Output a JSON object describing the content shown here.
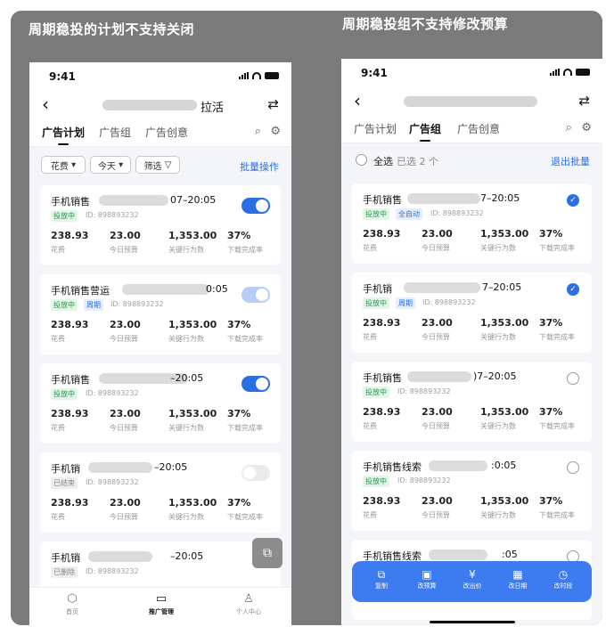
{
  "captions": {
    "left": "周期稳投的计划不支持关闭",
    "right": "周期稳投组不支持修改预算"
  },
  "status": {
    "time": "9:41"
  },
  "left_phone": {
    "nav_title": "拉活",
    "tabs": [
      "广告计划",
      "广告组",
      "广告创意"
    ],
    "active_tab": "广告计划",
    "filters": {
      "cost": "花费",
      "today": "今天",
      "filter": "筛选"
    },
    "batch": "批量操作",
    "cards": [
      {
        "name": "手机销售",
        "time": "07–20:05",
        "tags": [
          {
            "text": "投放中",
            "style": "green"
          }
        ],
        "id": "ID: 898893232",
        "toggle": "on",
        "values": [
          "238.93",
          "23.00",
          "1,353.00",
          "37%"
        ]
      },
      {
        "name": "手机销售营运",
        "time": "0:05",
        "tags": [
          {
            "text": "投放中",
            "style": "green"
          },
          {
            "text": "周期",
            "style": "blue"
          }
        ],
        "id": "ID: 898893232",
        "toggle": "dim",
        "values": [
          "238.93",
          "23.00",
          "1,353.00",
          "37%"
        ]
      },
      {
        "name": "手机销售",
        "time": "–20:05",
        "tags": [
          {
            "text": "投放中",
            "style": "green"
          }
        ],
        "id": "ID: 898893232",
        "toggle": "on",
        "values": [
          "238.93",
          "23.00",
          "1,353.00",
          "37%"
        ]
      },
      {
        "name": "手机销",
        "time": "–20:05",
        "tags": [
          {
            "text": "已结束",
            "style": "gray"
          }
        ],
        "id": "ID: 898893232",
        "toggle": "off",
        "values": [
          "238.93",
          "23.00",
          "1,353.00",
          "37%"
        ]
      },
      {
        "name": "手机销",
        "time": "–20:05",
        "tags": [
          {
            "text": "已删除",
            "style": "gray"
          }
        ],
        "id": "ID: 898893232",
        "toggle": "none",
        "values": []
      }
    ],
    "metric_labels": [
      "花费",
      "今日预算",
      "关键行为数",
      "下载完成率"
    ],
    "tabbar": [
      {
        "label": "首页",
        "icon": "home-icon",
        "glyph": "⬡"
      },
      {
        "label": "推广管理",
        "icon": "folder-icon",
        "glyph": "▭"
      },
      {
        "label": "个人中心",
        "icon": "person-icon",
        "glyph": "♙"
      }
    ],
    "active_tabbar": "推广管理",
    "float_glyph": "⧉"
  },
  "right_phone": {
    "tabs": [
      "广告计划",
      "广告组",
      "广告创意"
    ],
    "active_tab": "广告组",
    "select_all": "全选",
    "selected_text": "已选 2 个",
    "exit_batch": "退出批量",
    "cards": [
      {
        "name": "手机销售",
        "time": "7–20:05",
        "tags": [
          {
            "text": "投放中",
            "style": "green"
          },
          {
            "text": "全自动",
            "style": "blue"
          }
        ],
        "id": "ID: 898893232",
        "checked": true,
        "values": [
          "238.93",
          "23.00",
          "1,353.00",
          "37%"
        ]
      },
      {
        "name": "手机销",
        "time": "7–20:05",
        "tags": [
          {
            "text": "投放中",
            "style": "green"
          },
          {
            "text": "周期",
            "style": "blue"
          }
        ],
        "id": "ID: 898893232",
        "checked": true,
        "values": [
          "238.93",
          "23.00",
          "1,353.00",
          "37%"
        ]
      },
      {
        "name": "手机销售",
        "time": ")7–20:05",
        "tags": [
          {
            "text": "投放中",
            "style": "green"
          }
        ],
        "id": "ID: 898893232",
        "checked": false,
        "values": [
          "238.93",
          "23.00",
          "1,353.00",
          "37%"
        ]
      },
      {
        "name": "手机销售线索",
        "time": ":0:05",
        "tags": [
          {
            "text": "投放中",
            "style": "green"
          }
        ],
        "id": "ID: 898893232",
        "checked": false,
        "values": [
          "238.93",
          "23.00",
          "1,353.00",
          "37%"
        ]
      },
      {
        "name": "手机销售线索",
        "time": ":05",
        "tags": [],
        "id": "",
        "checked": false,
        "values": []
      }
    ],
    "metric_labels": [
      "花费",
      "今日预算",
      "关键行为数",
      "下载完成率"
    ],
    "actions": [
      {
        "label": "复制",
        "icon": "copy-icon",
        "glyph": "⧉"
      },
      {
        "label": "改预算",
        "icon": "wallet-icon",
        "glyph": "▣"
      },
      {
        "label": "改出价",
        "icon": "yen-icon",
        "glyph": "¥"
      },
      {
        "label": "改日期",
        "icon": "calendar-icon",
        "glyph": "▦"
      },
      {
        "label": "改时段",
        "icon": "clock-icon",
        "glyph": "◷"
      }
    ]
  },
  "colors": {
    "accent": "#2b6fe5",
    "action_bar": "#3d7bf0",
    "backdrop": "#7a7a7a"
  }
}
